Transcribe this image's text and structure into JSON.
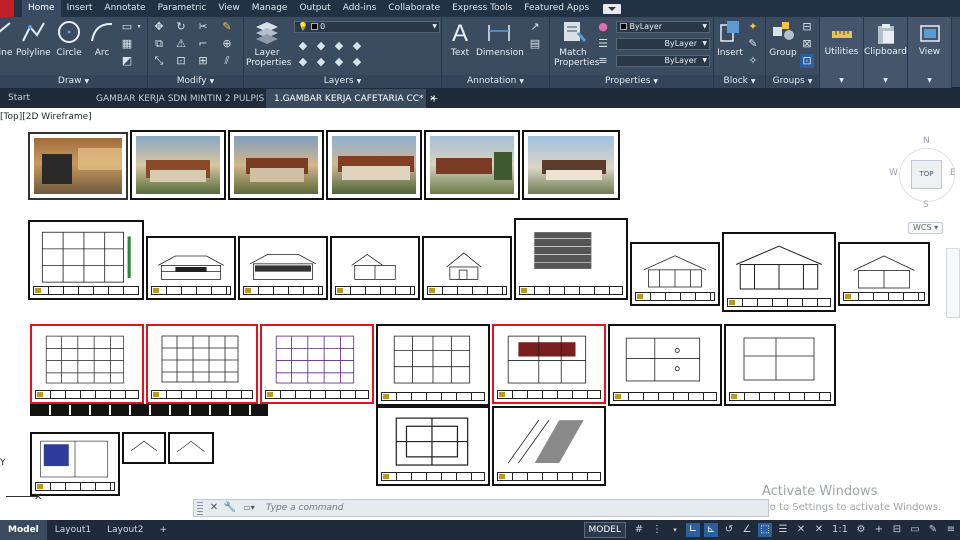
{
  "menu": {
    "tabs": [
      "Home",
      "Insert",
      "Annotate",
      "Parametric",
      "View",
      "Manage",
      "Output",
      "Add-ins",
      "Collaborate",
      "Express Tools",
      "Featured Apps"
    ],
    "active": "Home"
  },
  "ribbon": {
    "draw": {
      "title": "Draw",
      "tools": [
        "Line",
        "Polyline",
        "Circle",
        "Arc"
      ]
    },
    "modify": {
      "title": "Modify"
    },
    "layers": {
      "title": "Layers",
      "layer_properties": "Layer Properties",
      "current_layer": "0"
    },
    "annotation": {
      "title": "Annotation",
      "text": "Text",
      "dimension": "Dimension"
    },
    "properties": {
      "title": "Properties",
      "match": "Match Properties",
      "color": "ByLayer",
      "linetype": "ByLayer",
      "lineweight": "ByLayer"
    },
    "block": {
      "title": "Block",
      "insert": "Insert"
    },
    "groups": {
      "title": "Groups",
      "group": "Group"
    },
    "utilities": "Utilities",
    "clipboard": "Clipboard",
    "view": "View"
  },
  "doc_tabs": [
    "Start",
    "GAMBAR KERJA SDN MINTIN 2 PULPIS",
    "1.GAMBAR KERJA CAFETARIA CC*"
  ],
  "viewport_label": "[Top][2D Wireframe]",
  "viewcube": {
    "north": "N",
    "south": "S",
    "east": "E",
    "west": "W",
    "face": "TOP",
    "wcs": "WCS"
  },
  "command": {
    "placeholder": "Type a command"
  },
  "watermark": {
    "title": "Activate Windows",
    "subtitle": "Go to Settings to activate Windows."
  },
  "layout_tabs": [
    "Model",
    "Layout1",
    "Layout2"
  ],
  "status": {
    "model": "MODEL",
    "scale": "1:1"
  },
  "colors": {
    "menubar": "#233145",
    "ribbon": "#3b4b60",
    "accent_red": "#e0141e",
    "canvas": "#ffffff",
    "status_active": "#2b5f9e"
  }
}
